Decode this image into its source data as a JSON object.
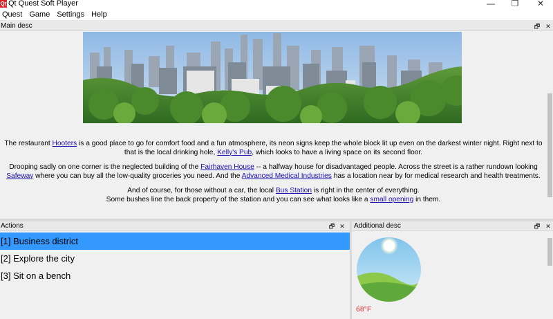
{
  "window": {
    "app_icon_text": "Qt",
    "title": "Qt Quest Soft Player",
    "minimize": "—",
    "maximize": "❐",
    "close": "✕"
  },
  "menu": [
    "Quest",
    "Game",
    "Settings",
    "Help"
  ],
  "main_desc": {
    "title": "Main desc",
    "float_btn": "🗗",
    "close_btn": "✕",
    "banner_icon": "city-skyline-image",
    "p1": {
      "t1": "The restaurant ",
      "l1": "Hooters",
      "t2": "  is a good place to go for comfort food and a fun atmosphere, its neon signs keep the whole block lit up even on the darkest winter night. Right next to that is the local drinking hole, ",
      "l2": "Kelly's Pub",
      "t3": ", which looks to have a living space on its second floor."
    },
    "p2": {
      "t1": "Drooping sadly on one corner is the neglected building of the ",
      "l1": "Fairhaven House",
      "t2": "  -- a halfway house for disadvantaged people. Across the street is a rather rundown looking ",
      "l2": "Safeway",
      "t3": "  where you can buy all the low-quality groceries you need. And the ",
      "l3": "Advanced Medical Industries",
      "t4": "  has a location near by for medical research and health treatments."
    },
    "p3": {
      "t1": "And of course, for those without a car, the local ",
      "l1": "Bus Station",
      "t2": "  is right in the center of everything.",
      "t3": "Some bushes line the back property of the station and you can see what looks like a ",
      "l2": "small opening",
      "t4": "  in them."
    }
  },
  "actions": {
    "title": "Actions",
    "float_btn": "🗗",
    "close_btn": "✕",
    "items": [
      {
        "label": "[1] Business district",
        "selected": true
      },
      {
        "label": "[2] Explore the city",
        "selected": false
      },
      {
        "label": "[3] Sit on a bench",
        "selected": false
      }
    ]
  },
  "additional_desc": {
    "title": "Additional desc",
    "float_btn": "🗗",
    "close_btn": "✕",
    "image_icon": "sunny-hills-weather-icon",
    "temperature": "68°F",
    "temperature_color": "#e02a2a"
  },
  "colors": {
    "selection": "#3399ff",
    "link": "#1a0dab",
    "app_icon": "#d71f26"
  }
}
